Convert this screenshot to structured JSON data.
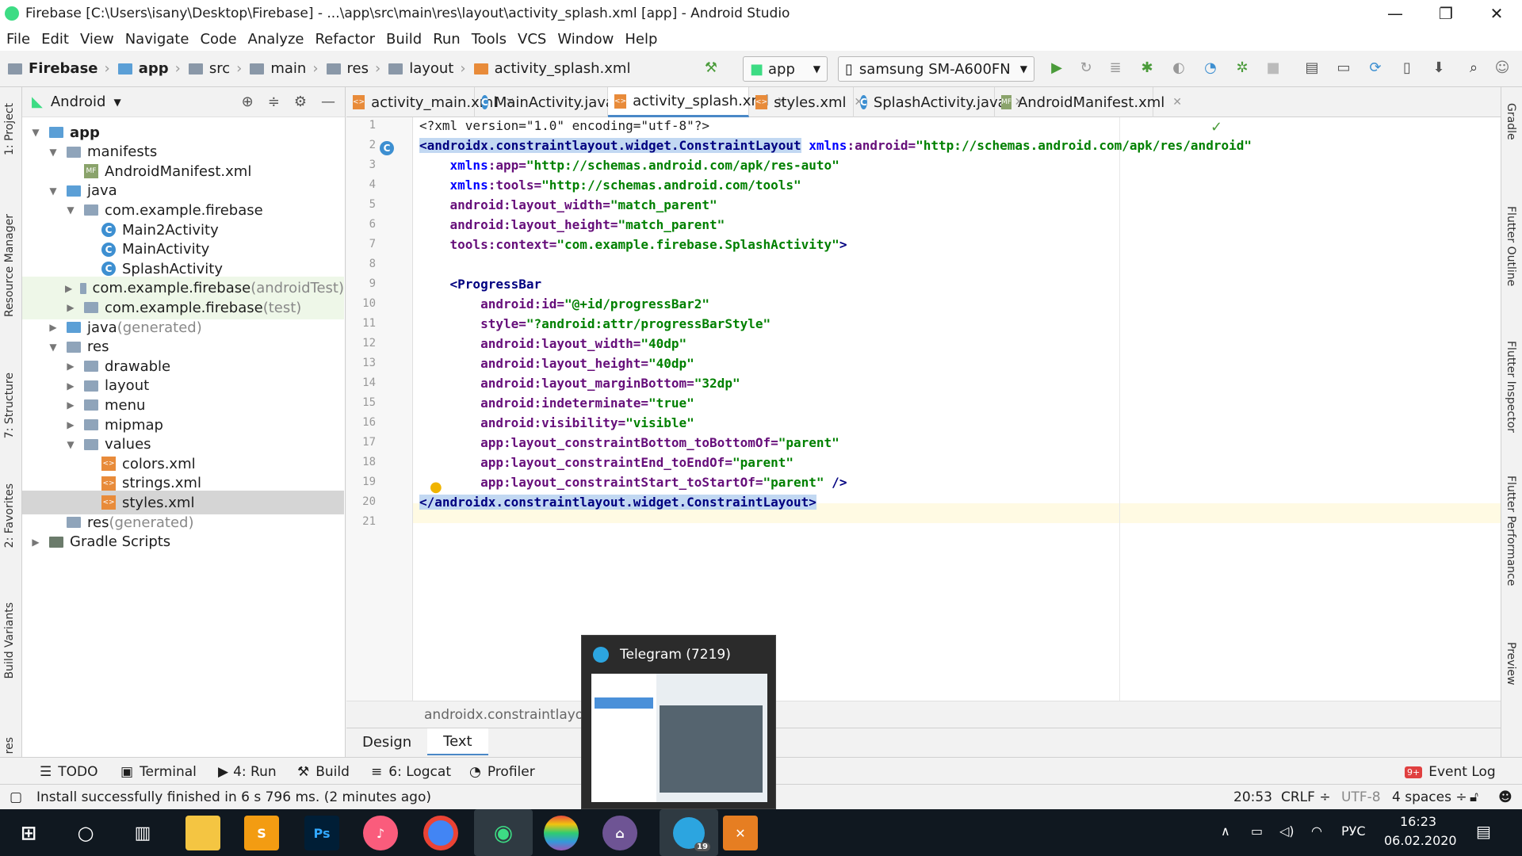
{
  "window": {
    "title": "Firebase [C:\\Users\\isany\\Desktop\\Firebase] - ...\\app\\src\\main\\res\\layout\\activity_splash.xml [app] - Android Studio",
    "minimize": "—",
    "maximize": "❐",
    "close": "✕"
  },
  "menu": [
    "File",
    "Edit",
    "View",
    "Navigate",
    "Code",
    "Analyze",
    "Refactor",
    "Build",
    "Run",
    "Tools",
    "VCS",
    "Window",
    "Help"
  ],
  "breadcrumb": [
    "Firebase",
    "app",
    "src",
    "main",
    "res",
    "layout",
    "activity_splash.xml"
  ],
  "toolbar": {
    "config": "app",
    "device": "samsung SM-A600FN"
  },
  "project_panel": {
    "view": "Android",
    "tree": [
      {
        "label": "app",
        "indent": 0,
        "arrow": "▼",
        "icon": "module",
        "bold": true
      },
      {
        "label": "manifests",
        "indent": 1,
        "arrow": "▼",
        "icon": "folder"
      },
      {
        "label": "AndroidManifest.xml",
        "indent": 2,
        "arrow": "",
        "icon": "mf"
      },
      {
        "label": "java",
        "indent": 1,
        "arrow": "▼",
        "icon": "folder-blue"
      },
      {
        "label": "com.example.firebase",
        "indent": 2,
        "arrow": "▼",
        "icon": "folder"
      },
      {
        "label": "Main2Activity",
        "indent": 3,
        "arrow": "",
        "icon": "class"
      },
      {
        "label": "MainActivity",
        "indent": 3,
        "arrow": "",
        "icon": "class"
      },
      {
        "label": "SplashActivity",
        "indent": 3,
        "arrow": "",
        "icon": "class"
      },
      {
        "label": "com.example.firebase",
        "suffix": " (androidTest)",
        "indent": 2,
        "arrow": "▶",
        "icon": "folder",
        "green": true
      },
      {
        "label": "com.example.firebase",
        "suffix": " (test)",
        "indent": 2,
        "arrow": "▶",
        "icon": "folder",
        "green": true
      },
      {
        "label": "java",
        "suffix": " (generated)",
        "indent": 1,
        "arrow": "▶",
        "icon": "folder-blue"
      },
      {
        "label": "res",
        "indent": 1,
        "arrow": "▼",
        "icon": "folder"
      },
      {
        "label": "drawable",
        "indent": 2,
        "arrow": "▶",
        "icon": "folder"
      },
      {
        "label": "layout",
        "indent": 2,
        "arrow": "▶",
        "icon": "folder"
      },
      {
        "label": "menu",
        "indent": 2,
        "arrow": "▶",
        "icon": "folder"
      },
      {
        "label": "mipmap",
        "indent": 2,
        "arrow": "▶",
        "icon": "folder"
      },
      {
        "label": "values",
        "indent": 2,
        "arrow": "▼",
        "icon": "folder"
      },
      {
        "label": "colors.xml",
        "indent": 3,
        "arrow": "",
        "icon": "xml"
      },
      {
        "label": "strings.xml",
        "indent": 3,
        "arrow": "",
        "icon": "xml"
      },
      {
        "label": "styles.xml",
        "indent": 3,
        "arrow": "",
        "icon": "xml",
        "selected": true
      },
      {
        "label": "res",
        "suffix": " (generated)",
        "indent": 1,
        "arrow": "",
        "icon": "folder"
      },
      {
        "label": "Gradle Scripts",
        "indent": 0,
        "arrow": "▶",
        "icon": "gradle"
      }
    ]
  },
  "editor_tabs": [
    {
      "label": "activity_main.xml",
      "icon": "xml"
    },
    {
      "label": "MainActivity.java",
      "icon": "class"
    },
    {
      "label": "activity_splash.xml",
      "icon": "xml",
      "active": true
    },
    {
      "label": "styles.xml",
      "icon": "xml"
    },
    {
      "label": "SplashActivity.java",
      "icon": "class"
    },
    {
      "label": "AndroidManifest.xml",
      "icon": "mf"
    }
  ],
  "code_lines": [
    "1",
    "2",
    "3",
    "4",
    "5",
    "6",
    "7",
    "8",
    "9",
    "10",
    "11",
    "12",
    "13",
    "14",
    "15",
    "16",
    "17",
    "18",
    "19",
    "20",
    "21"
  ],
  "code": {
    "l1": "<?xml version=\"1.0\" encoding=\"utf-8\"?>",
    "l2_tag": "<androidx.constraintlayout.widget.ConstraintLayout",
    "l2_ns": " xmlns",
    "l2_attr": ":android=",
    "l2_val": "\"http://schemas.android.com/apk/res/android\"",
    "l3_ns": "    xmlns",
    "l3_attr": ":app=",
    "l3_val": "\"http://schemas.android.com/apk/res-auto\"",
    "l4_ns": "    xmlns",
    "l4_attr": ":tools=",
    "l4_val": "\"http://schemas.android.com/tools\"",
    "l5_attr": "    android:layout_width=",
    "l5_val": "\"match_parent\"",
    "l6_attr": "    android:layout_height=",
    "l6_val": "\"match_parent\"",
    "l7_attr": "    tools:context=",
    "l7_val": "\"com.example.firebase.SplashActivity\"",
    "l7_end": ">",
    "l9_tag": "    <ProgressBar",
    "l10_attr": "        android:id=",
    "l10_val": "\"@+id/progressBar2\"",
    "l11_attr": "        style=",
    "l11_val": "\"?android:attr/progressBarStyle\"",
    "l12_attr": "        android:layout_width=",
    "l12_val": "\"40dp\"",
    "l13_attr": "        android:layout_height=",
    "l13_val": "\"40dp\"",
    "l14_attr": "        android:layout_marginBottom=",
    "l14_val": "\"32dp\"",
    "l15_attr": "        android:indeterminate=",
    "l15_val": "\"true\"",
    "l16_attr": "        android:visibility=",
    "l16_val": "\"visible\"",
    "l17_attr": "        app:layout_constraintBottom_toBottomOf=",
    "l17_val": "\"parent\"",
    "l18_attr": "        app:layout_constraintEnd_toEndOf=",
    "l18_val": "\"parent\"",
    "l19_attr": "        app:layout_constraintStart_toStartOf=",
    "l19_val": "\"parent\"",
    "l19_end": " />",
    "l20": "</androidx.constraintlayout.widget.ConstraintLayout>"
  },
  "editor_breadcrumb": "androidx.constraintlayout",
  "design_tabs": [
    "Design",
    "Text"
  ],
  "left_tabs": [
    "1: Project",
    "Resource Manager",
    "7: Structure",
    "2: Favorites",
    "Build Variants",
    "res"
  ],
  "right_tabs": [
    "Gradle",
    "Flutter Outline",
    "Flutter Inspector",
    "Flutter Performance",
    "Preview"
  ],
  "tool_windows": [
    "TODO",
    "Terminal",
    "4: Run",
    "Build",
    "6: Logcat",
    "Profiler"
  ],
  "event_log": "Event Log",
  "event_count": "9+",
  "status": {
    "message": "Install successfully finished in 6 s 796 ms. (2 minutes ago)",
    "position": "20:53",
    "line_sep": "CRLF ÷",
    "encoding": "UTF-8",
    "indent": "4 spaces ÷"
  },
  "telegram_popup": {
    "title": "Telegram (7219)"
  },
  "taskbar": {
    "language": "РУС",
    "time": "16:23",
    "date": "06.02.2020",
    "telegram_badge": "19"
  }
}
